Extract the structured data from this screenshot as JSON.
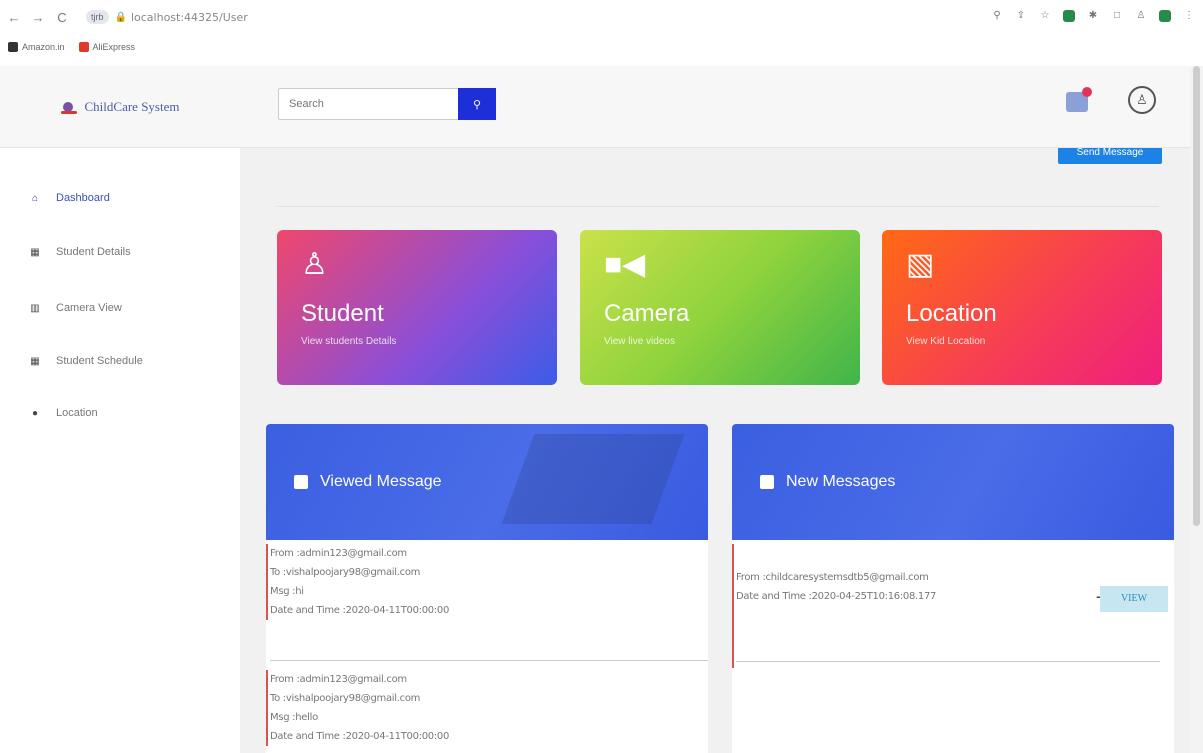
{
  "browser": {
    "nav": [
      "←",
      "→",
      "C"
    ],
    "site_badge": "tjrb",
    "url": "localhost:44325/User",
    "bookmarks": [
      {
        "label": "Amazon.in",
        "color": "#333333"
      },
      {
        "label": "AliExpress",
        "color": "#e0382b"
      }
    ]
  },
  "header": {
    "logo_text": "ChildCare System",
    "search_placeholder": "Search",
    "search_icon": "search-icon"
  },
  "sidebar": {
    "items": [
      {
        "label": "Dashboard",
        "icon": "dashboard-icon",
        "glyph": "⌂",
        "active": true
      },
      {
        "label": "Student Details",
        "icon": "table-icon",
        "glyph": "▦",
        "active": false
      },
      {
        "label": "Camera View",
        "icon": "chart-icon",
        "glyph": "▥",
        "active": false
      },
      {
        "label": "Student Schedule",
        "icon": "calendar-icon",
        "glyph": "▦",
        "active": false
      },
      {
        "label": "Location",
        "icon": "map-pin-icon",
        "glyph": "●",
        "active": false
      }
    ]
  },
  "main": {
    "send_button": "Send Message",
    "cards": [
      {
        "title": "Student",
        "subtitle": "View students Details",
        "icon": "user-icon"
      },
      {
        "title": "Camera",
        "subtitle": "View live videos",
        "icon": "video-camera-icon"
      },
      {
        "title": "Location",
        "subtitle": "View Kid Location",
        "icon": "map-icon"
      }
    ],
    "viewed_panel": {
      "title": "Viewed Message",
      "messages": [
        {
          "from": "From :admin123@gmail.com",
          "to": "To :vishalpoojary98@gmail.com",
          "msg": "Msg :hi",
          "date": "Date and Time :2020-04-11T00:00:00"
        },
        {
          "from": "From :admin123@gmail.com",
          "to": "To :vishalpoojary98@gmail.com",
          "msg": "Msg :hello",
          "date": "Date and Time :2020-04-11T00:00:00"
        }
      ]
    },
    "new_panel": {
      "title": "New Messages",
      "messages": [
        {
          "from": "From :childcaresystemsdtb5@gmail.com",
          "date": "Date and Time :2020-04-25T10:16:08.177",
          "button": "VIEW"
        }
      ]
    }
  },
  "colors": {
    "accent": "#1d2fd9",
    "panel_blue": "#3a5fe0",
    "send_button": "#1c82e6"
  }
}
